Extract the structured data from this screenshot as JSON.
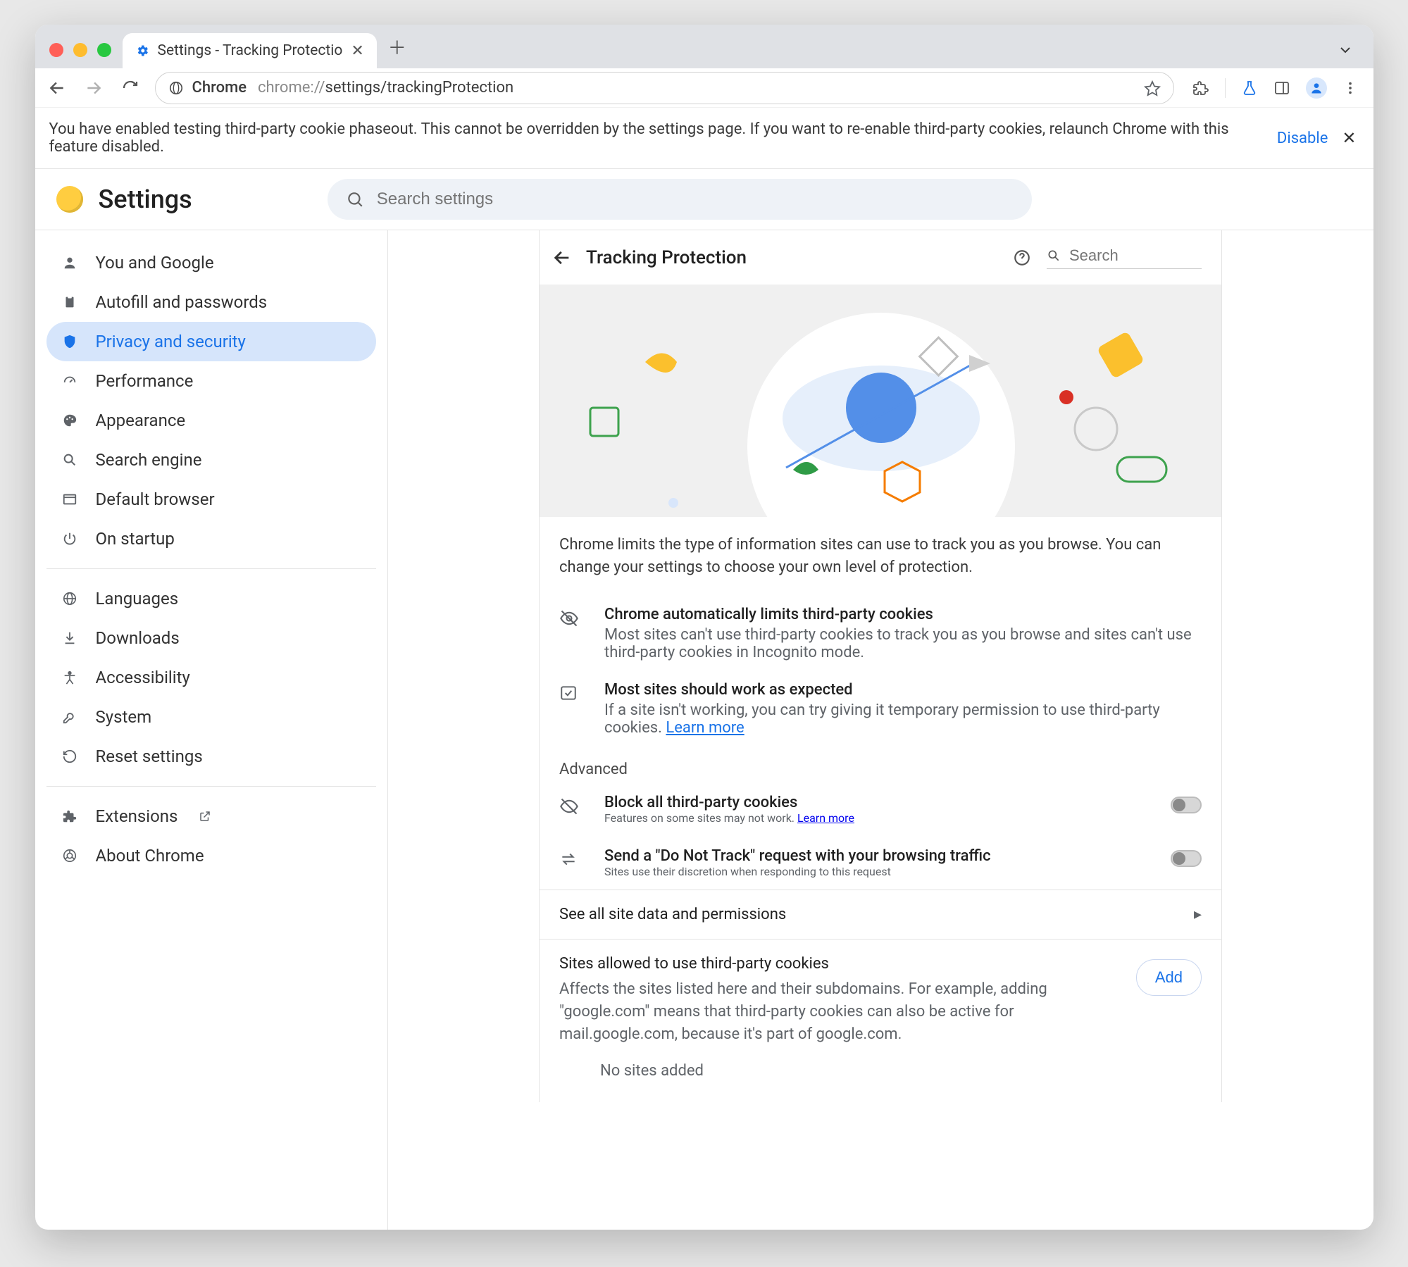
{
  "chrome": {
    "tab_title": "Settings - Tracking Protectio",
    "url_prefix": "Chrome",
    "url_faint": "chrome://",
    "url_rest": "settings/trackingProtection"
  },
  "banner": {
    "text": "You have enabled testing third-party cookie phaseout. This cannot be overridden by the settings page. If you want to re-enable third-party cookies, relaunch Chrome with this feature disabled.",
    "link": "Disable"
  },
  "app": {
    "title": "Settings",
    "search_placeholder": "Search settings"
  },
  "sidebar": {
    "items": [
      {
        "label": "You and Google"
      },
      {
        "label": "Autofill and passwords"
      },
      {
        "label": "Privacy and security",
        "active": true
      },
      {
        "label": "Performance"
      },
      {
        "label": "Appearance"
      },
      {
        "label": "Search engine"
      },
      {
        "label": "Default browser"
      },
      {
        "label": "On startup"
      }
    ],
    "group2": [
      {
        "label": "Languages"
      },
      {
        "label": "Downloads"
      },
      {
        "label": "Accessibility"
      },
      {
        "label": "System"
      },
      {
        "label": "Reset settings"
      }
    ],
    "group3": [
      {
        "label": "Extensions",
        "external": true
      },
      {
        "label": "About Chrome"
      }
    ]
  },
  "page": {
    "title": "Tracking Protection",
    "search_placeholder": "Search",
    "intro": "Chrome limits the type of information sites can use to track you as you browse. You can change your settings to choose your own level of protection.",
    "info1_title": "Chrome automatically limits third-party cookies",
    "info1_body": "Most sites can't use third-party cookies to track you as you browse and sites can't use third-party cookies in Incognito mode.",
    "info2_title": "Most sites should work as expected",
    "info2_body": "If a site isn't working, you can try giving it temporary permission to use third-party cookies.",
    "learn_more": "Learn more",
    "advanced_label": "Advanced",
    "block_title": "Block all third-party cookies",
    "block_body": "Features on some sites may not work.",
    "dnt_title": "Send a \"Do Not Track\" request with your browsing traffic",
    "dnt_body": "Sites use their discretion when responding to this request",
    "see_all": "See all site data and permissions",
    "sites_title": "Sites allowed to use third-party cookies",
    "sites_body": "Affects the sites listed here and their subdomains. For example, adding \"google.com\" means that third-party cookies can also be active for mail.google.com, because it's part of google.com.",
    "add_label": "Add",
    "no_sites": "No sites added"
  }
}
